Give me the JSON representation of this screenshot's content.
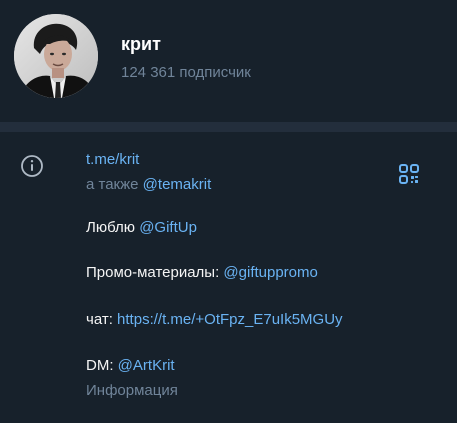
{
  "profile": {
    "name": "крит",
    "subscribers": "124 361 подписчик"
  },
  "info": {
    "link": "t.me/krit",
    "also_prefix": "а также",
    "also_link": "@temakrit",
    "love_prefix": "Люблю",
    "love_link": "@GiftUp",
    "promo_prefix": "Промо-материалы:",
    "promo_link": "@giftuppromo",
    "chat_prefix": "чат:",
    "chat_link": "https://t.me/+OtFpz_E7uIk5MGUy",
    "dm_prefix": "DM:",
    "dm_link": "@ArtKrit",
    "caption": "Информация"
  },
  "colors": {
    "background": "#17212b",
    "divider": "#232e3c",
    "link": "#6ab3f3",
    "muted": "#708499",
    "text": "#f5f5f5"
  },
  "icons": {
    "info": "info-circle-icon",
    "qr": "qr-code-icon"
  }
}
